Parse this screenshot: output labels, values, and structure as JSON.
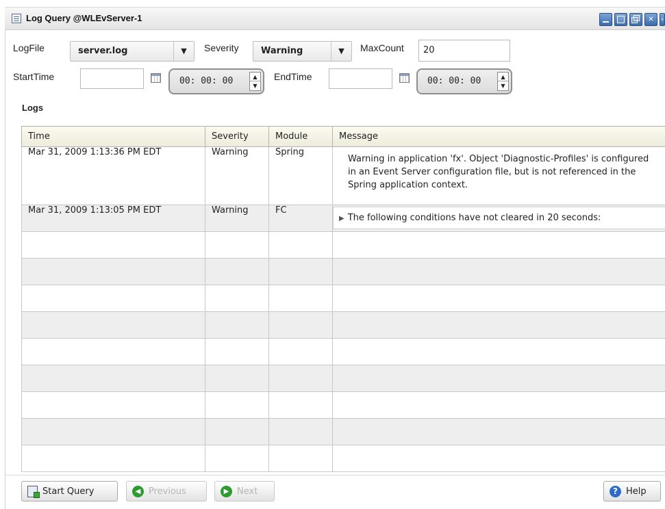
{
  "window": {
    "title": "Log Query @WLEvServer-1"
  },
  "filters": {
    "logfile_label": "LogFile",
    "logfile_value": "server.log",
    "severity_label": "Severity",
    "severity_value": "Warning",
    "maxcount_label": "MaxCount",
    "maxcount_value": "20",
    "starttime_label": "StartTime",
    "starttime_value": "",
    "starttime_clock": "00: 00: 00",
    "endtime_label": "EndTime",
    "endtime_value": "",
    "endtime_clock": "00: 00: 00"
  },
  "logs": {
    "section_title": "Logs",
    "columns": [
      "Time",
      "Severity",
      "Module",
      "Message"
    ],
    "rows": [
      {
        "time": "Mar 31, 2009 1:13:36 PM EDT",
        "severity": "Warning",
        "module": "Spring",
        "message": "Warning in application 'fx'.  Object 'Diagnostic-Profiles' is configured in an Event Server configuration file, but is not referenced in the Spring application context."
      },
      {
        "time": "Mar 31, 2009 1:13:05 PM EDT",
        "severity": "Warning",
        "module": "FC",
        "message": "The following conditions have not cleared in 20 seconds:"
      }
    ]
  },
  "buttons": {
    "start_query": "Start Query",
    "previous": "Previous",
    "next": "Next",
    "help": "Help"
  }
}
